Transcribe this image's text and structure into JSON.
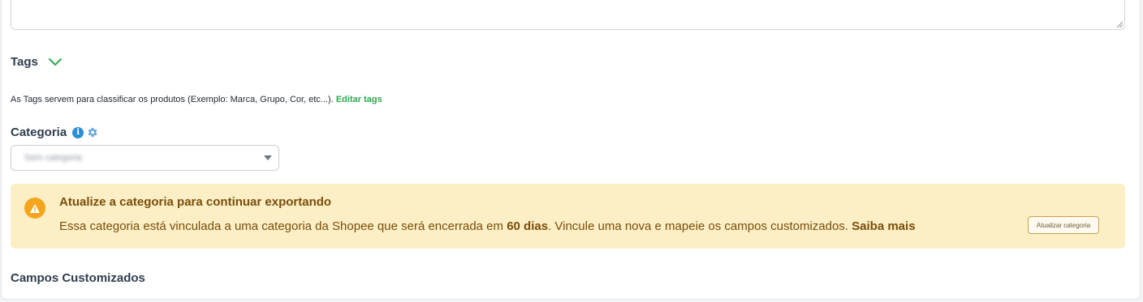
{
  "tags": {
    "title": "Tags",
    "help_text": "As Tags servem para classificar os produtos (Exemplo: Marca, Grupo, Cor, etc...). ",
    "edit_link": "Editar tags"
  },
  "category": {
    "title": "Categoria",
    "info_icon": "info-icon",
    "settings_icon": "gear-icon",
    "select_value": "Sem categoria"
  },
  "alert": {
    "icon": "warning-icon",
    "title": "Atualize a categoria para continuar exportando",
    "body_part1": "Essa categoria está vinculada a uma categoria da Shopee que será encerrada em ",
    "body_bold": "60 dias",
    "body_part2": ". Vincule uma nova e mapeie os campos customizados. ",
    "learn_more": "Saiba mais",
    "button_label": "Atualizar categoria",
    "background_color": "#fcefc5",
    "text_color": "#7a4d0a",
    "icon_color": "#f3a61c"
  },
  "custom_fields": {
    "title": "Campos Customizados"
  },
  "colors": {
    "accent_green": "#2ea84f",
    "info_blue": "#2b8fd6"
  }
}
